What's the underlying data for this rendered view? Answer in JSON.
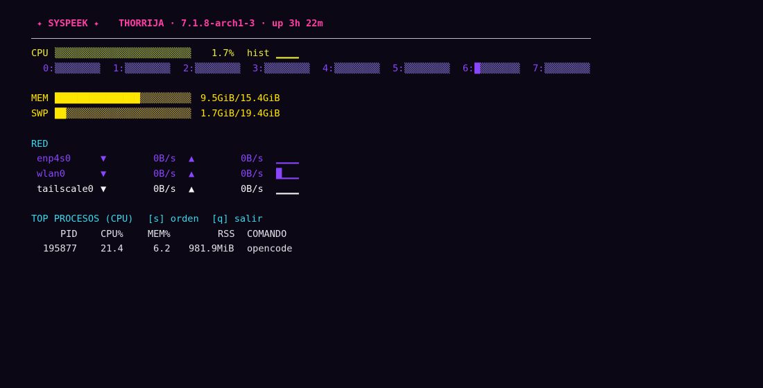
{
  "header": {
    "app_title": "✦ SYSPEEK ✦",
    "host_info": "THORRIJA · 7.1.8-arch1-3 · up 3h 22m"
  },
  "cpu": {
    "label": "CPU",
    "bar": "▒▒▒▒▒▒▒▒▒▒▒▒▒▒▒▒▒▒▒▒▒▒▒▒",
    "percent": "1.7%",
    "hist_label": "hist",
    "hist_graph": "▁▁▁▁",
    "usage_fraction": 0.017,
    "cores": [
      {
        "label": "0:",
        "bar": "▒▒▒▒▒▒▒▒",
        "fill": 0.0
      },
      {
        "label": "1:",
        "bar": "▒▒▒▒▒▒▒▒",
        "fill": 0.0
      },
      {
        "label": "2:",
        "bar": "▒▒▒▒▒▒▒▒",
        "fill": 0.0
      },
      {
        "label": "3:",
        "bar": "▒▒▒▒▒▒▒▒",
        "fill": 0.0
      },
      {
        "label": "4:",
        "bar": "▒▒▒▒▒▒▒▒",
        "fill": 0.0
      },
      {
        "label": "5:",
        "bar": "▒▒▒▒▒▒▒▒",
        "fill": 0.0
      },
      {
        "label": "6:",
        "bar": "█▒▒▒▒▒▒▒",
        "fill": 0.125
      },
      {
        "label": "7:",
        "bar": "▒▒▒▒▒▒▒▒",
        "fill": 0.0
      }
    ]
  },
  "memory": {
    "mem_label": "MEM",
    "mem_bar_filled": "███████████████",
    "mem_bar_empty": "▒▒▒▒▒▒▒▒▒",
    "mem_value": "9.5GiB/15.4GiB",
    "mem_fraction": 0.62,
    "swp_label": "SWP",
    "swp_bar_filled": "██",
    "swp_bar_empty": "▒▒▒▒▒▒▒▒▒▒▒▒▒▒▒▒▒▒▒▒▒▒",
    "swp_value": "1.7GiB/19.4GiB",
    "swp_fraction": 0.09
  },
  "network": {
    "title": "RED",
    "interfaces": [
      {
        "name": "enp4s0",
        "down_arrow": "▼",
        "down": "0B/s",
        "up_arrow": "▲",
        "up": "0B/s",
        "graph": "▁▁▁▁"
      },
      {
        "name": "wlan0",
        "down_arrow": "▼",
        "down": "0B/s",
        "up_arrow": "▲",
        "up": "0B/s",
        "graph": "█▁▁▁"
      },
      {
        "name": "tailscale0",
        "down_arrow": "▼",
        "down": "0B/s",
        "up_arrow": "▲",
        "up": "0B/s",
        "graph": "▁▁▁▁"
      }
    ]
  },
  "processes": {
    "title": "TOP PROCESOS (CPU)",
    "sort_hint": "[s] orden",
    "quit_hint": "[q] salir",
    "columns": [
      "PID",
      "CPU%",
      "MEM%",
      "RSS",
      "COMANDO"
    ],
    "rows": [
      {
        "pid": "195877",
        "cpu": "21.4",
        "mem": "6.2",
        "rss": "981.9MiB",
        "command": "opencode"
      }
    ]
  },
  "colors": {
    "background": "#0c0714",
    "accent_pink": "#ff3ea5",
    "cpu_yellow": "#ecec36",
    "mem_gold": "#ffe600",
    "section_cyan": "#3ad6ea",
    "net_purple": "#8a45ff"
  }
}
